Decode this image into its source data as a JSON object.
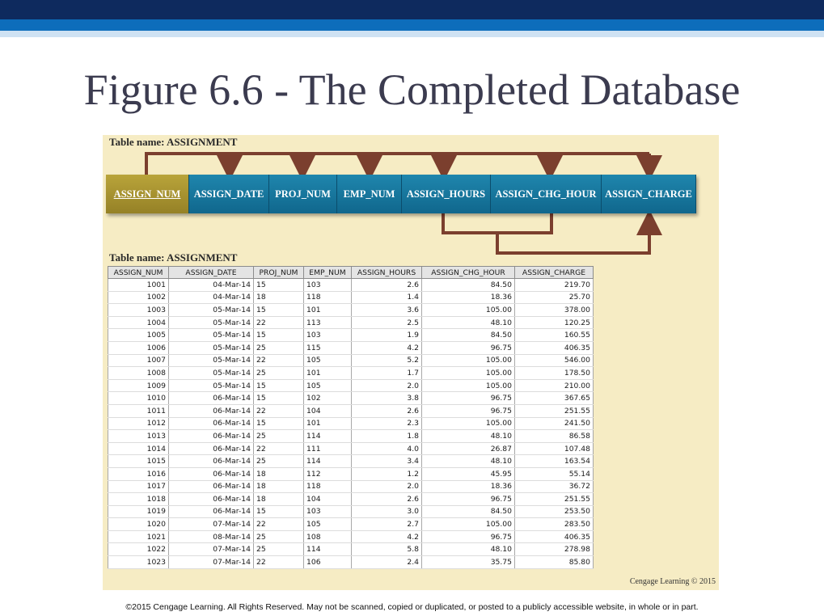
{
  "title": "Figure 6.6 - The Completed Database",
  "dependency_diagram": {
    "table_label": "Table name: ASSIGNMENT",
    "columns": [
      "ASSIGN_NUM",
      "ASSIGN_DATE",
      "PROJ_NUM",
      "EMP_NUM",
      "ASSIGN_HOURS",
      "ASSIGN_CHG_HOUR",
      "ASSIGN_CHARGE"
    ],
    "primary_key": "ASSIGN_NUM",
    "colors": {
      "primary_key": "#a89330",
      "attribute": "#177aa0",
      "arrow": "#7b3f2e",
      "panel": "#f6ecc4"
    }
  },
  "table": {
    "label": "Table name: ASSIGNMENT",
    "headers": [
      "ASSIGN_NUM",
      "ASSIGN_DATE",
      "PROJ_NUM",
      "EMP_NUM",
      "ASSIGN_HOURS",
      "ASSIGN_CHG_HOUR",
      "ASSIGN_CHARGE"
    ],
    "rows": [
      [
        "1001",
        "04-Mar-14",
        "15",
        "103",
        "2.6",
        "84.50",
        "219.70"
      ],
      [
        "1002",
        "04-Mar-14",
        "18",
        "118",
        "1.4",
        "18.36",
        "25.70"
      ],
      [
        "1003",
        "05-Mar-14",
        "15",
        "101",
        "3.6",
        "105.00",
        "378.00"
      ],
      [
        "1004",
        "05-Mar-14",
        "22",
        "113",
        "2.5",
        "48.10",
        "120.25"
      ],
      [
        "1005",
        "05-Mar-14",
        "15",
        "103",
        "1.9",
        "84.50",
        "160.55"
      ],
      [
        "1006",
        "05-Mar-14",
        "25",
        "115",
        "4.2",
        "96.75",
        "406.35"
      ],
      [
        "1007",
        "05-Mar-14",
        "22",
        "105",
        "5.2",
        "105.00",
        "546.00"
      ],
      [
        "1008",
        "05-Mar-14",
        "25",
        "101",
        "1.7",
        "105.00",
        "178.50"
      ],
      [
        "1009",
        "05-Mar-14",
        "15",
        "105",
        "2.0",
        "105.00",
        "210.00"
      ],
      [
        "1010",
        "06-Mar-14",
        "15",
        "102",
        "3.8",
        "96.75",
        "367.65"
      ],
      [
        "1011",
        "06-Mar-14",
        "22",
        "104",
        "2.6",
        "96.75",
        "251.55"
      ],
      [
        "1012",
        "06-Mar-14",
        "15",
        "101",
        "2.3",
        "105.00",
        "241.50"
      ],
      [
        "1013",
        "06-Mar-14",
        "25",
        "114",
        "1.8",
        "48.10",
        "86.58"
      ],
      [
        "1014",
        "06-Mar-14",
        "22",
        "111",
        "4.0",
        "26.87",
        "107.48"
      ],
      [
        "1015",
        "06-Mar-14",
        "25",
        "114",
        "3.4",
        "48.10",
        "163.54"
      ],
      [
        "1016",
        "06-Mar-14",
        "18",
        "112",
        "1.2",
        "45.95",
        "55.14"
      ],
      [
        "1017",
        "06-Mar-14",
        "18",
        "118",
        "2.0",
        "18.36",
        "36.72"
      ],
      [
        "1018",
        "06-Mar-14",
        "18",
        "104",
        "2.6",
        "96.75",
        "251.55"
      ],
      [
        "1019",
        "06-Mar-14",
        "15",
        "103",
        "3.0",
        "84.50",
        "253.50"
      ],
      [
        "1020",
        "07-Mar-14",
        "22",
        "105",
        "2.7",
        "105.00",
        "283.50"
      ],
      [
        "1021",
        "08-Mar-14",
        "25",
        "108",
        "4.2",
        "96.75",
        "406.35"
      ],
      [
        "1022",
        "07-Mar-14",
        "25",
        "114",
        "5.8",
        "48.10",
        "278.98"
      ],
      [
        "1023",
        "07-Mar-14",
        "22",
        "106",
        "2.4",
        "35.75",
        "85.80"
      ]
    ]
  },
  "credit": "Cengage Learning © 2015",
  "footer": "©2015 Cengage Learning. All Rights Reserved. May not be scanned, copied or duplicated, or posted to a publicly accessible website, in whole or in part."
}
